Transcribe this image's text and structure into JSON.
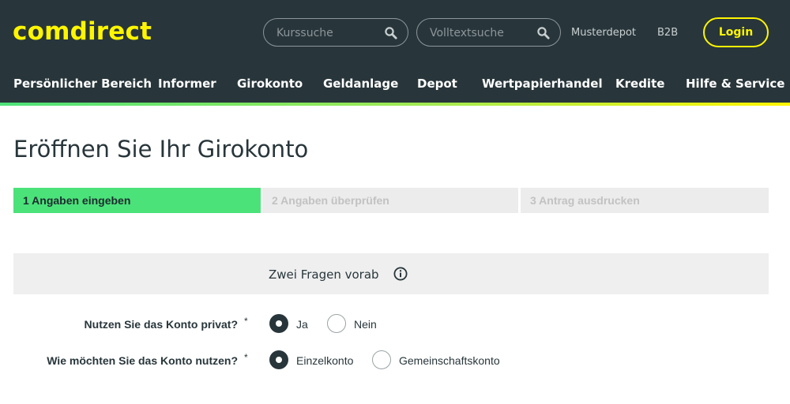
{
  "header": {
    "logo": "comdirect",
    "search_kurs": {
      "placeholder": "Kurssuche",
      "icon": "search-icon"
    },
    "search_volltext": {
      "placeholder": "Volltextsuche",
      "icon": "search-icon"
    },
    "links": [
      "Musterdepot",
      "B2B"
    ],
    "login_label": "Login"
  },
  "nav": {
    "items": [
      "Persönlicher Bereich",
      "Informer",
      "Girokonto",
      "Geldanlage",
      "Depot",
      "Wertpapierhandel",
      "Kredite",
      "Hilfe & Service"
    ]
  },
  "page": {
    "title": "Eröffnen Sie Ihr Girokonto"
  },
  "steps": [
    {
      "label": "1 Angaben eingeben",
      "active": true
    },
    {
      "label": "2 Angaben überprüfen",
      "active": false
    },
    {
      "label": "3 Antrag ausdrucken",
      "active": false
    }
  ],
  "section": {
    "title": "Zwei Fragen vorab",
    "icon": "info-icon"
  },
  "questions": [
    {
      "label": "Nutzen Sie das Konto privat?",
      "required_mark": "*",
      "options": [
        {
          "label": "Ja",
          "selected": true
        },
        {
          "label": "Nein",
          "selected": false
        }
      ]
    },
    {
      "label": "Wie möchten Sie das Konto nutzen?",
      "required_mark": "*",
      "options": [
        {
          "label": "Einzelkonto",
          "selected": true
        },
        {
          "label": "Gemeinschaftskonto",
          "selected": false
        }
      ]
    }
  ],
  "colors": {
    "header_bg": "#28363b",
    "brand_yellow": "#fff500",
    "active_step": "#4be27a",
    "inactive_step": "#ececec"
  }
}
